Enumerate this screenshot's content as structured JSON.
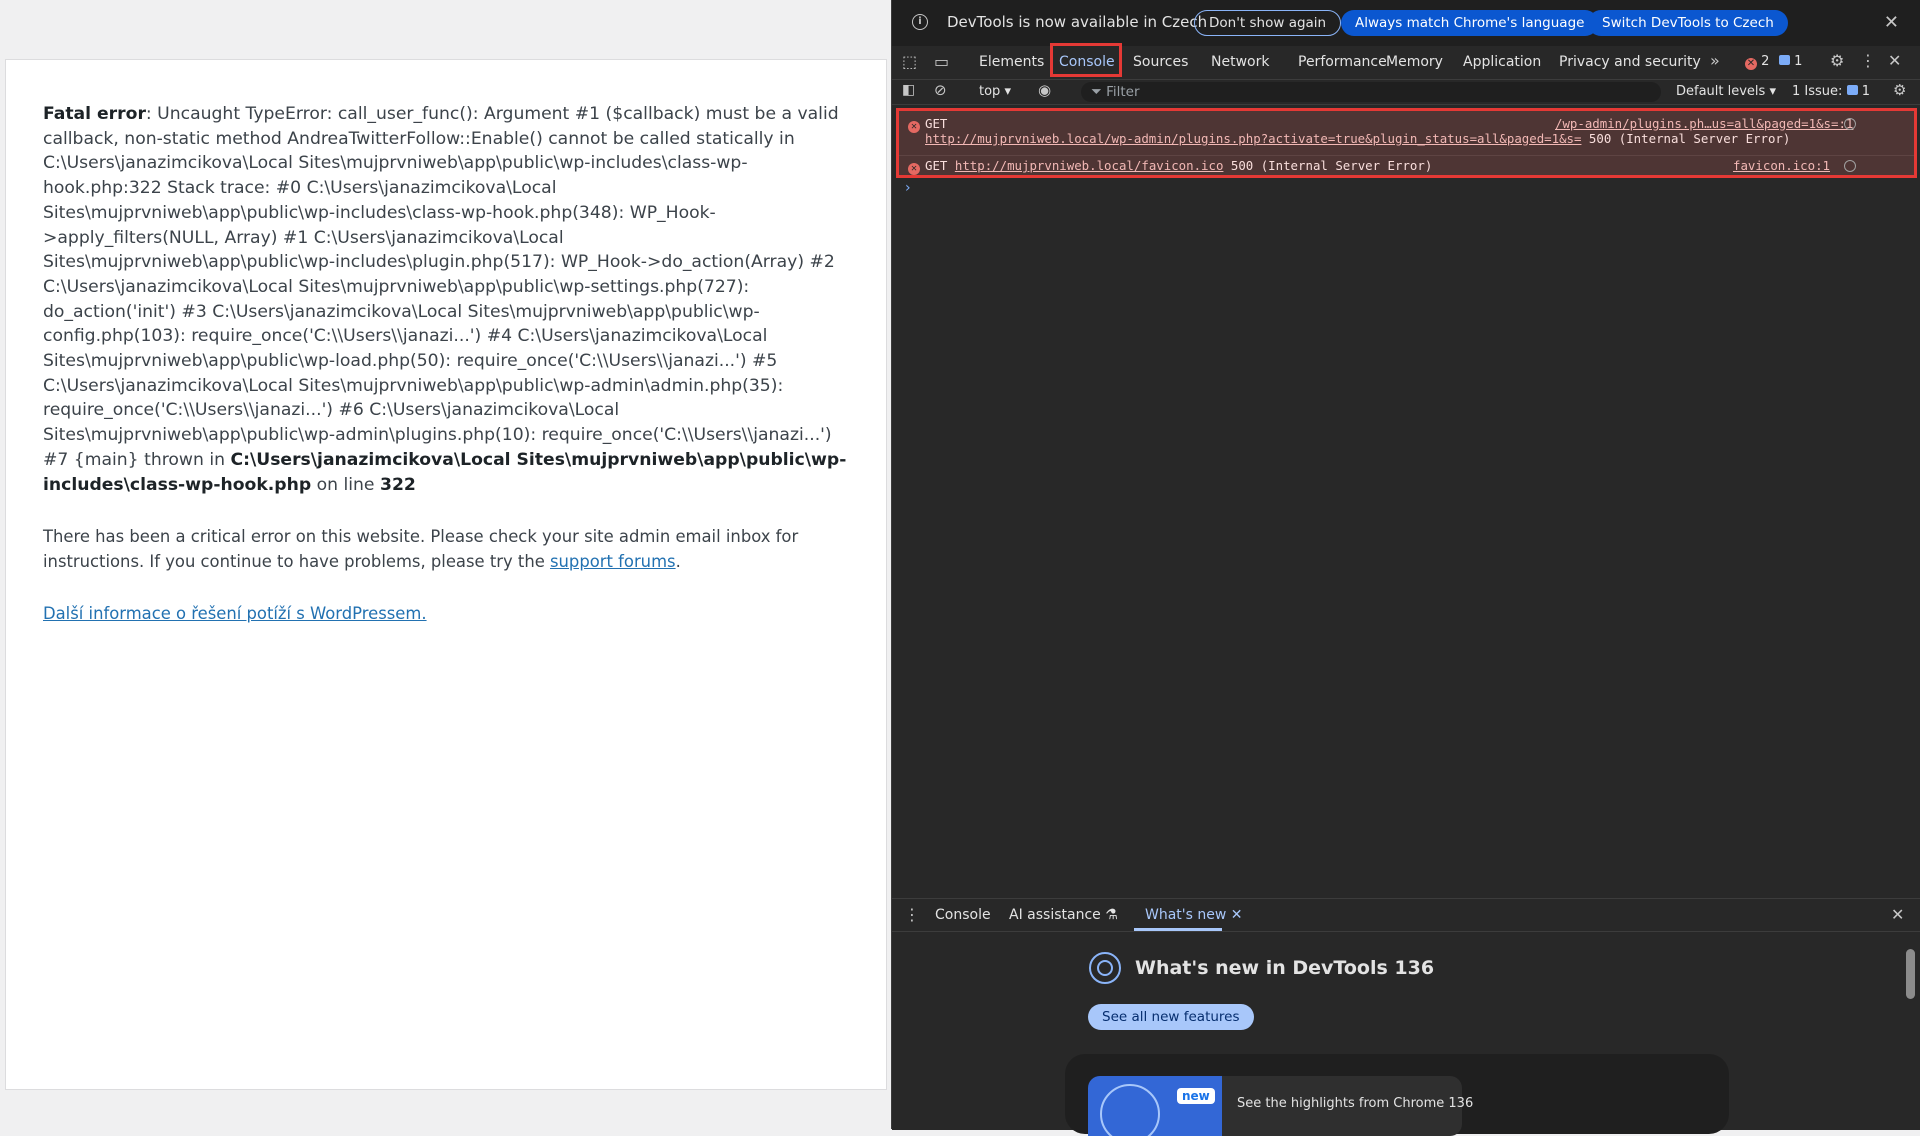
{
  "page": {
    "fatal_label": "Fatal error",
    "fatal_message": ": Uncaught TypeError: call_user_func(): Argument #1 ($callback) must be a valid callback, non-static method AndreaTwitterFollow::Enable() cannot be called statically in C:\\Users\\janazimcikova\\Local Sites\\mujprvniweb\\app\\public\\wp-includes\\class-wp-hook.php:322 Stack trace: #0 C:\\Users\\janazimcikova\\Local Sites\\mujprvniweb\\app\\public\\wp-includes\\class-wp-hook.php(348): WP_Hook->apply_filters(NULL, Array) #1 C:\\Users\\janazimcikova\\Local Sites\\mujprvniweb\\app\\public\\wp-includes\\plugin.php(517): WP_Hook->do_action(Array) #2 C:\\Users\\janazimcikova\\Local Sites\\mujprvniweb\\app\\public\\wp-settings.php(727): do_action('init') #3 C:\\Users\\janazimcikova\\Local Sites\\mujprvniweb\\app\\public\\wp-config.php(103): require_once('C:\\\\Users\\\\janazi...') #4 C:\\Users\\janazimcikova\\Local Sites\\mujprvniweb\\app\\public\\wp-load.php(50): require_once('C:\\\\Users\\\\janazi...') #5 C:\\Users\\janazimcikova\\Local Sites\\mujprvniweb\\app\\public\\wp-admin\\admin.php(35): require_once('C:\\\\Users\\\\janazi...') #6 C:\\Users\\janazimcikova\\Local Sites\\mujprvniweb\\app\\public\\wp-admin\\plugins.php(10): require_once('C:\\\\Users\\\\janazi...') #7 {main} thrown in ",
    "fatal_file": "C:\\Users\\janazimcikova\\Local Sites\\mujprvniweb\\app\\public\\wp-includes\\class-wp-hook.php",
    "on_line_text": " on line ",
    "line_number": "322",
    "critical_text": "There has been a critical error on this website. Please check your site admin email inbox for instructions. If you continue to have problems, please try the ",
    "support_link": "support forums",
    "period": ".",
    "more_info_link": "Další informace o řešení potíží s WordPressem."
  },
  "devtools": {
    "infobar": {
      "message": "DevTools is now available in Czech",
      "dont_show": "Don't show again",
      "always_match": "Always match Chrome's language",
      "switch": "Switch DevTools to Czech"
    },
    "tabs": [
      "Elements",
      "Console",
      "Sources",
      "Network",
      "Performance",
      "Memory",
      "Application",
      "Privacy and security"
    ],
    "error_count": "2",
    "message_count": "1",
    "toolbar": {
      "context": "top",
      "filter_placeholder": "Filter",
      "levels": "Default levels",
      "issues_label": "1 Issue:",
      "issues_count": "1"
    },
    "messages": [
      {
        "method": "GET",
        "url": "http://mujprvniweb.local/wp-admin/plugins.php?activate=true&plugin_status=all&paged=1&s=",
        "status": " 500 (Internal Server Error)",
        "source": "/wp-admin/plugins.ph…us=all&paged=1&s=:1"
      },
      {
        "method": "GET",
        "url": "http://mujprvniweb.local/favicon.ico",
        "status": " 500 (Internal Server Error)",
        "source": "favicon.ico:1"
      }
    ],
    "drawer": {
      "tabs": [
        "Console",
        "AI assistance",
        "What's new"
      ],
      "whats_new_title": "What's new in DevTools 136",
      "see_all": "See all new features",
      "card_badge": "new",
      "card_text": "See the highlights from Chrome 136"
    },
    "colors": {
      "accent": "#a8c7fa",
      "error_bg": "#4e3534",
      "highlight": "#e53935",
      "link": "#2271b1"
    }
  }
}
